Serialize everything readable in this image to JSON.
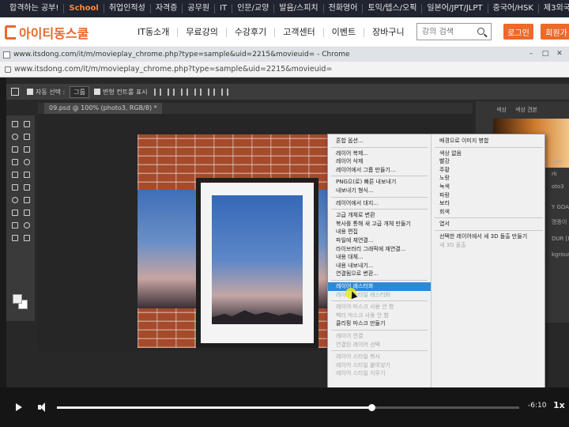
{
  "top_categories": [
    "합격하는 공부!",
    "School",
    "취업인적성",
    "자격증",
    "공무원",
    "IT",
    "인문/교양",
    "발음/스피치",
    "전화영어",
    "토익/텝스/오픽",
    "일본어/JPT/JLPT",
    "중국어/HSK",
    "제3외국"
  ],
  "site": {
    "logo_text": "아이티동스쿨",
    "nav": [
      "IT동소개",
      "무료강의",
      "수강후기",
      "고객센터",
      "이벤트",
      "장바구니"
    ],
    "search_placeholder": "강의 검색",
    "login_label": "로그인",
    "signup_label": "회원가"
  },
  "chrome": {
    "window_title": "www.itsdong.com/it/m/movieplay_chrome.php?type=sample&uid=2215&movieuid= - Chrome",
    "url": "www.itsdong.com/it/m/movieplay_chrome.php?type=sample&uid=2215&movieuid="
  },
  "photoshop": {
    "options_bar": {
      "auto_select_label": "자동 선택 :",
      "auto_select_value": "그룹",
      "transform_label": "변형 컨트롤 표시"
    },
    "doc_tab": "09.psd @ 100% (photo3, RGB/8) *",
    "panel_tabs": [
      "색상",
      "색상 견본"
    ],
    "layer_labels": [
      "Mat",
      "rk",
      "oto3",
      "Y GOAI is",
      "명증이",
      "DUR [M",
      "kgroun"
    ]
  },
  "context_menu": {
    "left": [
      {
        "label": "혼합 옵션...",
        "disabled": false
      },
      {
        "label": "레이어 복제...",
        "disabled": false
      },
      {
        "label": "레이어 삭제",
        "disabled": false
      },
      {
        "label": "레이어에서 그룹 만들기...",
        "disabled": false
      },
      {
        "label": "PNG으(로) 빠른 내보내기",
        "disabled": false
      },
      {
        "label": "내보내기 형식...",
        "disabled": false
      },
      {
        "label": "레이어에서 대지...",
        "disabled": false
      },
      {
        "label": "고급 개체로 변환",
        "disabled": false
      },
      {
        "label": "복사를 통해 새 고급 개체 만들기",
        "disabled": false
      },
      {
        "label": "내용 편집",
        "disabled": false
      },
      {
        "label": "파일에 재연결...",
        "disabled": false
      },
      {
        "label": "라이브러리 그래픽에 재연결...",
        "disabled": false
      },
      {
        "label": "내용 대체...",
        "disabled": false
      },
      {
        "label": "내용 내보내기...",
        "disabled": false
      },
      {
        "label": "연결됨으로 변환...",
        "disabled": false
      },
      {
        "label": "레이어 래스터화",
        "disabled": false,
        "selected": true
      },
      {
        "label": "레이어 스타일 래스터화",
        "disabled": true
      },
      {
        "label": "레이어 마스크 사용 안 함",
        "disabled": true
      },
      {
        "label": "벡터 마스크 사용 안 함",
        "disabled": true
      },
      {
        "label": "클리핑 마스크 만들기",
        "disabled": false
      },
      {
        "label": "레이어 연결",
        "disabled": true
      },
      {
        "label": "연결된 레이어 선택",
        "disabled": true
      },
      {
        "label": "레이어 스타일 복사",
        "disabled": true
      },
      {
        "label": "레이어 스타일 붙여넣기",
        "disabled": true
      },
      {
        "label": "레이어 스타일 지우기",
        "disabled": true
      }
    ],
    "right": [
      {
        "label": "배경으로 이미지 병합",
        "disabled": false
      },
      {
        "label": "색상 없음",
        "disabled": false
      },
      {
        "label": "빨강",
        "disabled": false
      },
      {
        "label": "주황",
        "disabled": false
      },
      {
        "label": "노랑",
        "disabled": false
      },
      {
        "label": "녹색",
        "disabled": false
      },
      {
        "label": "파랑",
        "disabled": false
      },
      {
        "label": "보라",
        "disabled": false
      },
      {
        "label": "회색",
        "disabled": false
      },
      {
        "label": "엽서",
        "disabled": false
      },
      {
        "label": "선택한 레이어에서 새 3D 돌출 만들기",
        "disabled": false
      },
      {
        "label": "새 3D 돌출",
        "disabled": true
      }
    ]
  },
  "video": {
    "time_remaining": "-6:10",
    "speed": "1x",
    "progress_fraction": 0.68
  },
  "colors": {
    "brand_orange": "#ec6a2a",
    "menu_highlight": "#2e88d8"
  },
  "icons": [
    "search-icon",
    "play-icon",
    "volume-icon",
    "move-tool-icon",
    "close-icon",
    "minimize-icon",
    "maximize-icon"
  ]
}
